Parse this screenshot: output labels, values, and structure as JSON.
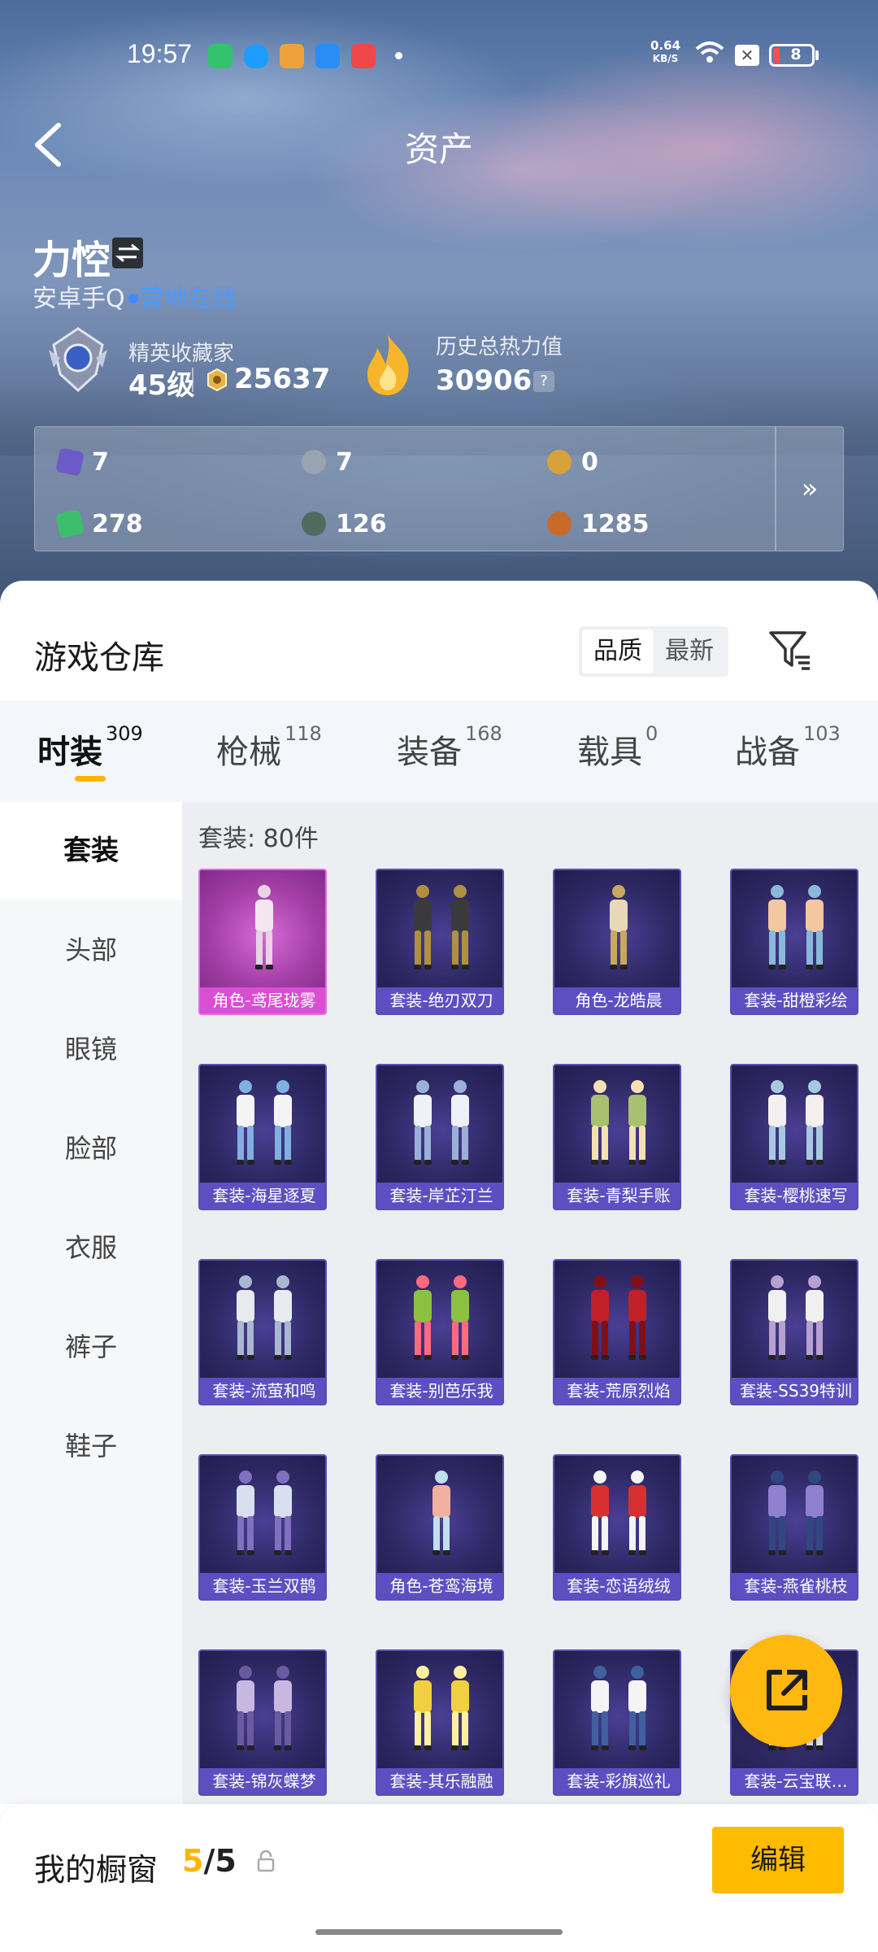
{
  "status_bar": {
    "time": "19:57",
    "net_speed": "0.64",
    "net_unit": "KB/S",
    "battery": "8",
    "apps": [
      "green-battery-app",
      "qq-app",
      "yellow-news-app",
      "blue-app",
      "red-video-app"
    ]
  },
  "header": {
    "title": "资产",
    "back_icon": "chevron-left-icon"
  },
  "profile": {
    "name": "力悾",
    "platform": "安卓手Q",
    "online_status": "营地在线",
    "rank_title": "精英收藏家",
    "rank_level": "45级",
    "coins": "25637",
    "heat_label": "历史总热力值",
    "heat_value": "30906",
    "help_icon": "?"
  },
  "resources": [
    {
      "icon": "purple-card-icon",
      "value": "7",
      "color": "#6b5ac8"
    },
    {
      "icon": "silver-token-icon",
      "value": "7",
      "color": "#9aa3b0"
    },
    {
      "icon": "gold-token-icon",
      "value": "0",
      "color": "#d7a23a"
    },
    {
      "icon": "green-ticket-icon",
      "value": "278",
      "color": "#3cbf6b"
    },
    {
      "icon": "dark-orb-icon",
      "value": "126",
      "color": "#4f6b5d"
    },
    {
      "icon": "bronze-coin-icon",
      "value": "1285",
      "color": "#c86a2a"
    }
  ],
  "resources_more": "»",
  "warehouse": {
    "title": "游戏仓库",
    "sort_options": [
      "品质",
      "最新"
    ],
    "active_sort": "品质"
  },
  "tabs": [
    {
      "label": "时装",
      "count": "309"
    },
    {
      "label": "枪械",
      "count": "118"
    },
    {
      "label": "装备",
      "count": "168"
    },
    {
      "label": "载具",
      "count": "0"
    },
    {
      "label": "战备",
      "count": "103"
    }
  ],
  "sidebar": [
    "套装",
    "头部",
    "眼镜",
    "脸部",
    "衣服",
    "裤子",
    "鞋子"
  ],
  "grid": {
    "count_label": "套装: 80件",
    "items": [
      {
        "label": "角色-鸢尾珑雾",
        "rarity": "pink"
      },
      {
        "label": "套装-绝刃双刀",
        "rarity": "purple"
      },
      {
        "label": "角色-龙皓晨",
        "rarity": "purple"
      },
      {
        "label": "套装-甜橙彩绘",
        "rarity": "purple"
      },
      {
        "label": "套装-海星逐夏",
        "rarity": "purple"
      },
      {
        "label": "套装-岸芷汀兰",
        "rarity": "purple"
      },
      {
        "label": "套装-青梨手账",
        "rarity": "purple"
      },
      {
        "label": "套装-樱桃速写",
        "rarity": "purple"
      },
      {
        "label": "套装-流萤和鸣",
        "rarity": "purple"
      },
      {
        "label": "套装-别芭乐我",
        "rarity": "purple"
      },
      {
        "label": "套装-荒原烈焰",
        "rarity": "purple"
      },
      {
        "label": "套装-SS39特训",
        "rarity": "purple"
      },
      {
        "label": "套装-玉兰双鹊",
        "rarity": "purple"
      },
      {
        "label": "角色-苍鸾海境",
        "rarity": "purple"
      },
      {
        "label": "套装-恋语绒绒",
        "rarity": "purple"
      },
      {
        "label": "套装-燕雀桃枝",
        "rarity": "purple"
      },
      {
        "label": "套装-锦灰蝶梦",
        "rarity": "purple"
      },
      {
        "label": "套装-其乐融融",
        "rarity": "purple"
      },
      {
        "label": "套装-彩旗巡礼",
        "rarity": "purple"
      },
      {
        "label": "套装-云宝联…",
        "rarity": "purple"
      }
    ]
  },
  "fab_icon": "share-external-icon",
  "showcase": {
    "label": "我的橱窗",
    "current": "5",
    "total": "/5"
  },
  "edit_label": "编辑",
  "colors": {
    "accent": "#ffb400",
    "online": "#4a9bff",
    "card_purple": "#5d4fc1",
    "card_pink": "#d94fd3"
  }
}
